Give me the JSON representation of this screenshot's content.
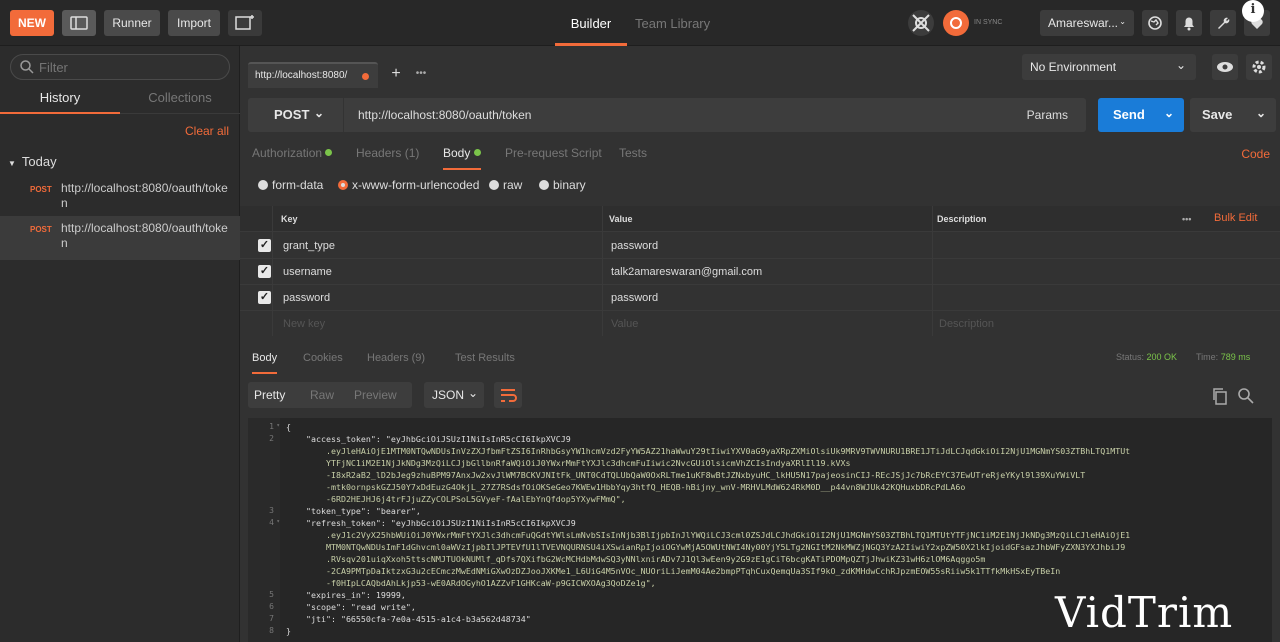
{
  "topbar": {
    "new_label": "NEW",
    "runner_label": "Runner",
    "import_label": "Import",
    "tabs": [
      "Builder",
      "Team Library"
    ],
    "sync_label": "IN SYNC",
    "user_label": "Amareswar...",
    "info_icon": "i"
  },
  "sidebar": {
    "filter_placeholder": "Filter",
    "tabs": [
      "History",
      "Collections"
    ],
    "clear_all": "Clear all",
    "group": "Today",
    "items": [
      {
        "method": "POST",
        "url": "http://localhost:8080/oauth/token"
      },
      {
        "method": "POST",
        "url": "http://localhost:8080/oauth/token"
      }
    ]
  },
  "request_tab": {
    "label": "http://localhost:8080/"
  },
  "environment": {
    "label": "No Environment"
  },
  "request": {
    "method": "POST",
    "url": "http://localhost:8080/oauth/token",
    "params_label": "Params",
    "send_label": "Send",
    "save_label": "Save",
    "tabs": {
      "authorization": "Authorization",
      "headers": "Headers (1)",
      "body": "Body",
      "prerequest": "Pre-request Script",
      "tests": "Tests"
    },
    "code_label": "Code",
    "body_types": [
      "form-data",
      "x-www-form-urlencoded",
      "raw",
      "binary"
    ],
    "selected_body_type": "x-www-form-urlencoded",
    "columns": {
      "key": "Key",
      "value": "Value",
      "description": "Description",
      "bulk_edit": "Bulk Edit",
      "more": "•••"
    },
    "rows": [
      {
        "key": "grant_type",
        "value": "password"
      },
      {
        "key": "username",
        "value": "talk2amareswaran@gmail.com"
      },
      {
        "key": "password",
        "value": "password"
      }
    ],
    "placeholders": {
      "key": "New key",
      "value": "Value",
      "description": "Description"
    }
  },
  "response": {
    "tabs": {
      "body": "Body",
      "cookies": "Cookies",
      "headers": "Headers (9)",
      "tests": "Test Results"
    },
    "status_label": "Status:",
    "status_value": "200 OK",
    "time_label": "Time:",
    "time_value": "789 ms",
    "formats": {
      "pretty": "Pretty",
      "raw": "Raw",
      "preview": "Preview"
    },
    "format_select": "JSON",
    "lines": [
      {
        "n": "1",
        "text": "{"
      },
      {
        "n": "2",
        "text": "    \"access_token\": \"eyJhbGciOiJSUzI1NiIsInR5cCI6IkpXVCJ9"
      },
      {
        "n": "",
        "text": "        .eyJleHAiOjE1MTM0NTQwNDUsInVzZXJfbmFtZSI6InRhbGsyYW1hcmVzd2FyYW5AZ21haWwuY29tIiwiYXV0aG9yaXRpZXMiOlsiUk9MRV9TWVNURU1BRE1JTiJdLCJqdGkiOiI2NjU1MGNmYS03ZTBhLTQ1MTUt"
      },
      {
        "n": "",
        "text": "        YTFjNC1iM2E1NjJkNDg3MzQiLCJjbGllbnRfaWQiOiJ0YWxrMmFtYXJlc3dhcmFuIiwic2NvcGUiOlsicmVhZCIsIndyaXRlIl19.kVXs"
      },
      {
        "n": "",
        "text": "        -I8xR2aB2_lD2bJeg9zhuBPM97AnxJw2xvJlWM7BCKVJNItFk_UNT0CdTQLUbQaW0OxRLTme1uKF8wBtJZNxbyuHC_lkHU5N17pajeosinCIJ-REcJSjJc7bRcEYC37EwUTreRjeYKyl9l39XuYWiVLT"
      },
      {
        "n": "",
        "text": "        -mtk0ornpskGZJ50Y7xDdEuzG4OkjL_27Z7RSdsfOiOKSeGeo7KWEw1HbbYqy3htfQ_HEQB-hBijny_wnV-MRHVLMdW624RkM0D__p44vn8WJUk42KQHuxbDRcPdLA6o"
      },
      {
        "n": "",
        "text": "        -6RD2HEJHJ6j4trFJjuZZyCOLPSoL5GVyeF-fAalEbYnQfdop5YXywFMmQ\","
      },
      {
        "n": "3",
        "text": "    \"token_type\": \"bearer\","
      },
      {
        "n": "4",
        "text": "    \"refresh_token\": \"eyJhbGciOiJSUzI1NiIsInR5cCI6IkpXVCJ9"
      },
      {
        "n": "",
        "text": "        .eyJ1c2VyX25hbWUiOiJ0YWxrMmFtYXJlc3dhcmFuQGdtYWlsLmNvbSIsInNjb3BlIjpbInJlYWQiLCJ3cml0ZSJdLCJhdGkiOiI2NjU1MGNmYS03ZTBhLTQ1MTUtYTFjNC1iM2E1NjJkNDg3MzQiLCJleHAiOjE1"
      },
      {
        "n": "",
        "text": "        MTM0NTQwNDUsImF1dGhvcml0aWVzIjpbIlJPTEVfU1lTVEVNQURNSU4iXSwianRpIjoiOGYwMjA5OWUtNWI4Ny00YjY5LTg2NGItM2NkMWZjNGQ3YzA2IiwiY2xpZW50X2lkIjoidGFsazJhbWFyZXN3YXJhbiJ9"
      },
      {
        "n": "",
        "text": "        .RVsqv201uiqXxoh5ttscNMJTUOkNUMlf_qDfs7QXifbG2WcMCHdbMdwSQ3yNNlxnirADv7J1Ql3wEen9y2G9zE1gCiT6bcgKATiPDOMpQZTjJhwiKZ31wH6zlOM6Aqggo5m"
      },
      {
        "n": "",
        "text": "        -2CA9PMTpDaIktzxG3u2cECmczMwEdNMiGXwOzDZJooJXKMe1_L6UiG4M5nVOc_NUOriLiJemM04Ae2bmpPTqhCuxQemqUa3SIf9kO_zdKMHdwCchRJpzmEOW55sRiiw5k1TTfkMkHSxEyTBeIn"
      },
      {
        "n": "",
        "text": "        -f0HIpLCAQbdAhLkjp53-wE0ARdOGyhO1AZZvF1GHKcaW-p9GICWXOAg3QoDZe1g\","
      },
      {
        "n": "5",
        "text": "    \"expires_in\": 19999,"
      },
      {
        "n": "6",
        "text": "    \"scope\": \"read write\","
      },
      {
        "n": "7",
        "text": "    \"jti\": \"66550cfa-7e0a-4515-a1c4-b3a562d48734\""
      },
      {
        "n": "8",
        "text": "}"
      }
    ]
  },
  "watermark": "VidTrim",
  "colors": {
    "accent": "#f26b3a",
    "send": "#1a7cd8",
    "status_ok": "#7bc44a"
  }
}
